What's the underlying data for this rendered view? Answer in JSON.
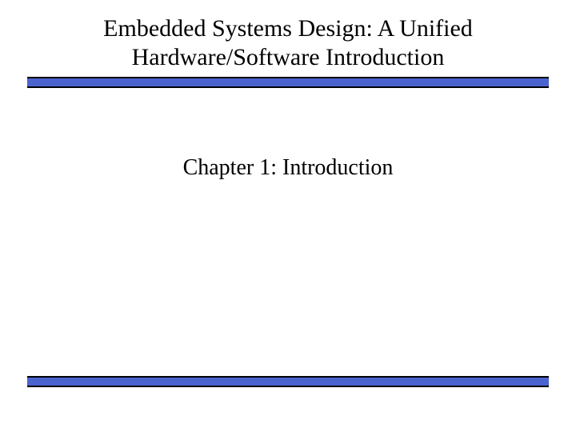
{
  "slide": {
    "title": "Embedded Systems Design: A Unified Hardware/Software Introduction",
    "subtitle": "Chapter 1: Introduction"
  },
  "colors": {
    "rule": "#4a63ce",
    "text": "#000000",
    "background": "#ffffff"
  }
}
